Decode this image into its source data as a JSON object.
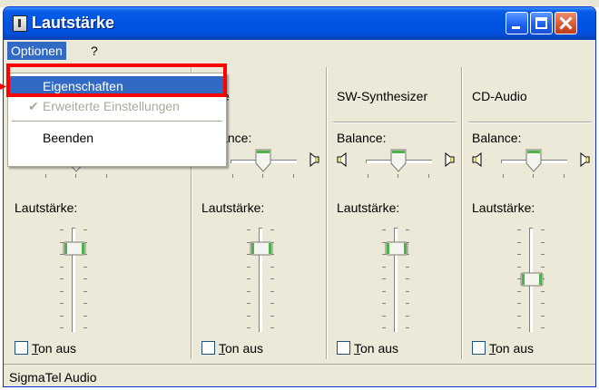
{
  "window": {
    "title": "Lautstärke"
  },
  "menubar": {
    "options": "Optionen",
    "help": "?"
  },
  "dropdown": {
    "items": [
      {
        "label": "Eigenschaften",
        "state": "highlighted"
      },
      {
        "label": "Erweiterte Einstellungen",
        "state": "disabled-checked",
        "check": "✔"
      },
      {
        "label": "Beenden",
        "state": "normal"
      }
    ]
  },
  "columns": [
    {
      "title": "",
      "balance_label": "",
      "volume_label": "Lautstärke:",
      "mute_underlined": "T",
      "mute_rest": "on aus",
      "muted": false,
      "balance": 0.5,
      "volume": 0.8
    },
    {
      "title": "ve",
      "balance_label": "lance:",
      "volume_label": "Lautstärke:",
      "mute_underlined": "T",
      "mute_rest": "on aus",
      "muted": false,
      "balance": 0.5,
      "volume": 0.8
    },
    {
      "title": "SW-Synthesizer",
      "balance_label": "Balance:",
      "volume_label": "Lautstärke:",
      "mute_underlined": "T",
      "mute_rest": "on aus",
      "muted": false,
      "balance": 0.5,
      "volume": 0.8
    },
    {
      "title": "CD-Audio",
      "balance_label": "Balance:",
      "volume_label": "Lautstärke:",
      "mute_underlined": "T",
      "mute_rest": "on aus",
      "muted": false,
      "balance": 0.5,
      "volume": 0.5
    }
  ],
  "statusbar": {
    "device": "SigmaTel Audio"
  },
  "colors": {
    "titlebar": "#0054e3",
    "highlight": "#316ac5",
    "annotation": "#ff0000",
    "slider_thumb": "#4fb14a"
  }
}
